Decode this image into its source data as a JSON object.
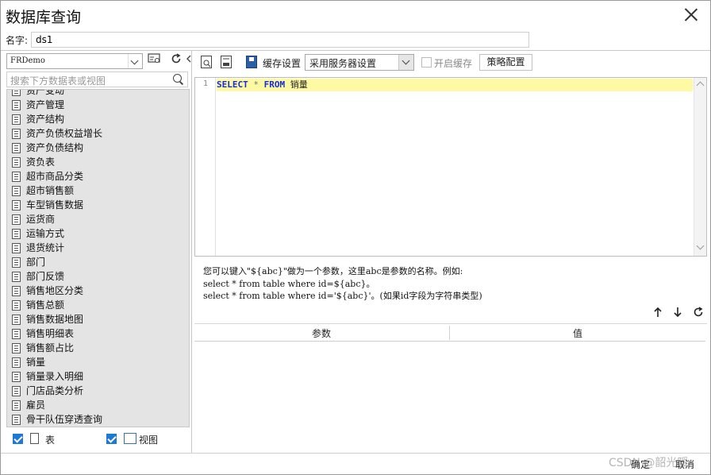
{
  "window": {
    "title": "数据库查询"
  },
  "name_field": {
    "label": "名字:",
    "value": "ds1"
  },
  "left_panel": {
    "database": "FRDemo",
    "search_placeholder": "搜索下方数据表或视图",
    "tables": [
      "资产变动",
      "资产管理",
      "资产结构",
      "资产负债权益增长",
      "资产负债结构",
      "资负表",
      "超市商品分类",
      "超市销售额",
      "车型销售数据",
      "运货商",
      "运输方式",
      "退货统计",
      "部门",
      "部门反馈",
      "销售地区分类",
      "销售总额",
      "销售数据地图",
      "销售明细表",
      "销售额占比",
      "销量",
      "销量录入明细",
      "门店品类分析",
      "雇员",
      "骨干队伍穿透查询"
    ],
    "filter_table_label": "表",
    "filter_view_label": "视图"
  },
  "toolbar": {
    "cache_label": "缓存设置",
    "cache_option": "采用服务器设置",
    "enable_cache_label": "开启缓存",
    "policy_button": "策略配置"
  },
  "editor": {
    "line_number": "1",
    "sql": {
      "kw1": "SELECT",
      "star": " * ",
      "kw2": "FROM",
      "table": " 销量"
    }
  },
  "help": {
    "line1": "您可以键入\"${abc}\"做为一个参数，这里abc是参数的名称。例如:",
    "line2": "select * from table where id=${abc}。",
    "line3": "select * from table where id='${abc}'。(如果id字段为字符串类型)"
  },
  "param_table": {
    "col_param": "参数",
    "col_value": "值"
  },
  "footer": {
    "ok": "确定",
    "cancel": "取消",
    "watermark": "CSDN @韶光暖"
  },
  "colors": {
    "accent": "#1e78d6",
    "highlight": "#fdfaa3",
    "keyword": "#1a2ad8"
  }
}
